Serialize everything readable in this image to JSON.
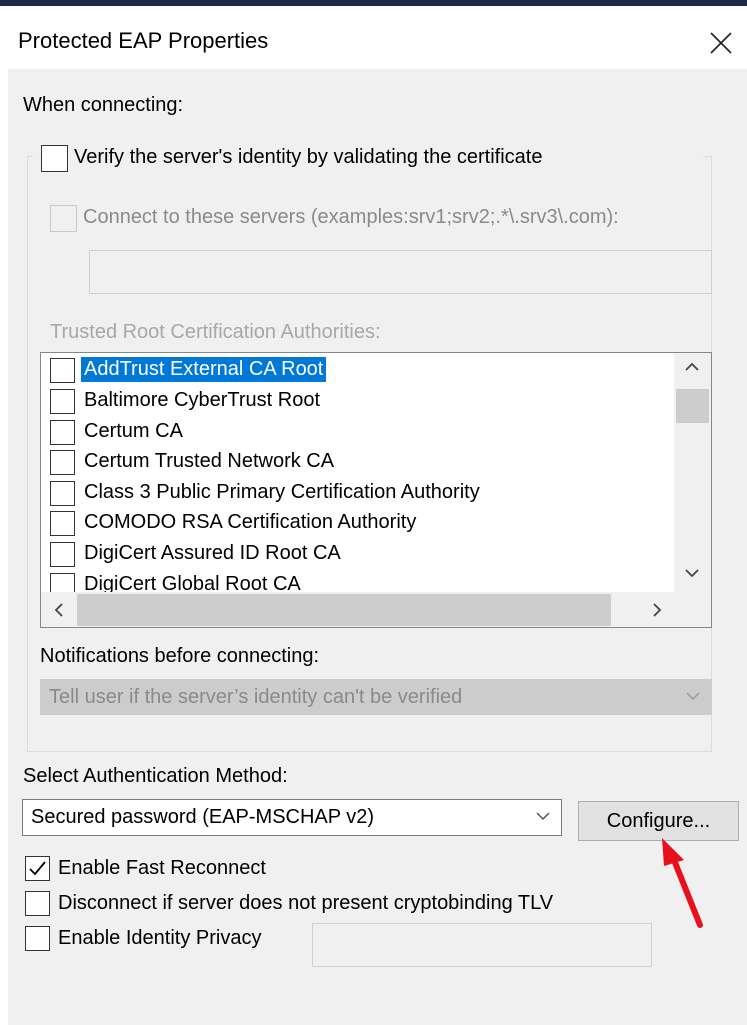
{
  "window": {
    "title": "Protected EAP Properties"
  },
  "when_connecting": {
    "label": "When connecting:"
  },
  "verify_server": {
    "label": "Verify the server's identity by validating the certificate",
    "checked": false
  },
  "connect_servers": {
    "label": "Connect to these servers (examples:srv1;srv2;.*\\.srv3\\.com):",
    "checked": false,
    "enabled": false,
    "value": ""
  },
  "trusted_root": {
    "label": "Trusted Root Certification Authorities:",
    "items": [
      {
        "label": "AddTrust External CA Root",
        "checked": false,
        "selected": true
      },
      {
        "label": "Baltimore CyberTrust Root",
        "checked": false
      },
      {
        "label": "Certum CA",
        "checked": false
      },
      {
        "label": "Certum Trusted Network CA",
        "checked": false
      },
      {
        "label": "Class 3 Public Primary Certification Authority",
        "checked": false
      },
      {
        "label": "COMODO RSA Certification Authority",
        "checked": false
      },
      {
        "label": "DigiCert Assured ID Root CA",
        "checked": false
      },
      {
        "label": "DigiCert Global Root CA",
        "checked": false
      }
    ]
  },
  "notifications": {
    "label": "Notifications before connecting:",
    "value": "Tell user if the server’s identity can't be verified",
    "enabled": false
  },
  "auth_method": {
    "label": "Select Authentication Method:",
    "value": "Secured password (EAP-MSCHAP v2)",
    "configure_label": "Configure..."
  },
  "options": {
    "fast_reconnect": {
      "label": "Enable Fast Reconnect",
      "checked": true
    },
    "cryptobinding": {
      "label": "Disconnect if server does not present cryptobinding TLV",
      "checked": false
    },
    "identity_privacy": {
      "label": "Enable Identity Privacy",
      "checked": false,
      "value": ""
    }
  },
  "colors": {
    "selection": "#0078d7",
    "annotation_arrow": "#e8101a",
    "dialog_bg": "#f0f0f0"
  }
}
